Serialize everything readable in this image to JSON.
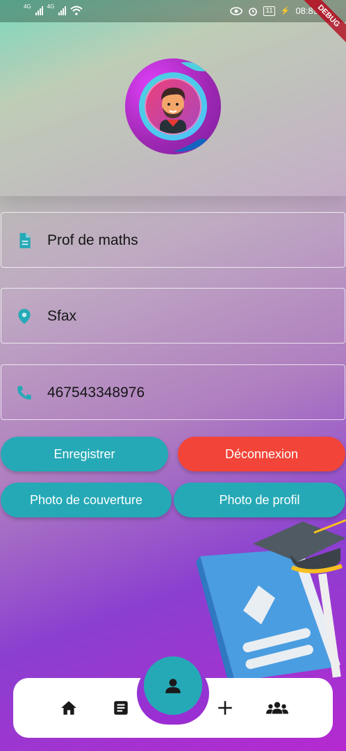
{
  "status_bar": {
    "network_1": "4G",
    "network_2": "4G",
    "battery": "11",
    "time": "08:89"
  },
  "debug_banner": "DEBUG",
  "profile": {
    "fields": [
      {
        "icon": "document-icon",
        "value": "Prof de maths"
      },
      {
        "icon": "location-pin-icon",
        "value": "Sfax"
      },
      {
        "icon": "phone-icon",
        "value": "467543348976"
      }
    ]
  },
  "actions": {
    "save_label": "Enregistrer",
    "logout_label": "Déconnexion",
    "cover_photo_label": "Photo de couverture",
    "profile_photo_label": "Photo de profil"
  },
  "colors": {
    "accent_teal": "#26a9b6",
    "danger_red": "#f24438"
  },
  "bottom_nav": {
    "items": [
      {
        "icon": "home-icon"
      },
      {
        "icon": "notes-icon"
      },
      {
        "icon": "profile-icon",
        "active": true
      },
      {
        "icon": "add-icon"
      },
      {
        "icon": "group-icon"
      }
    ]
  }
}
